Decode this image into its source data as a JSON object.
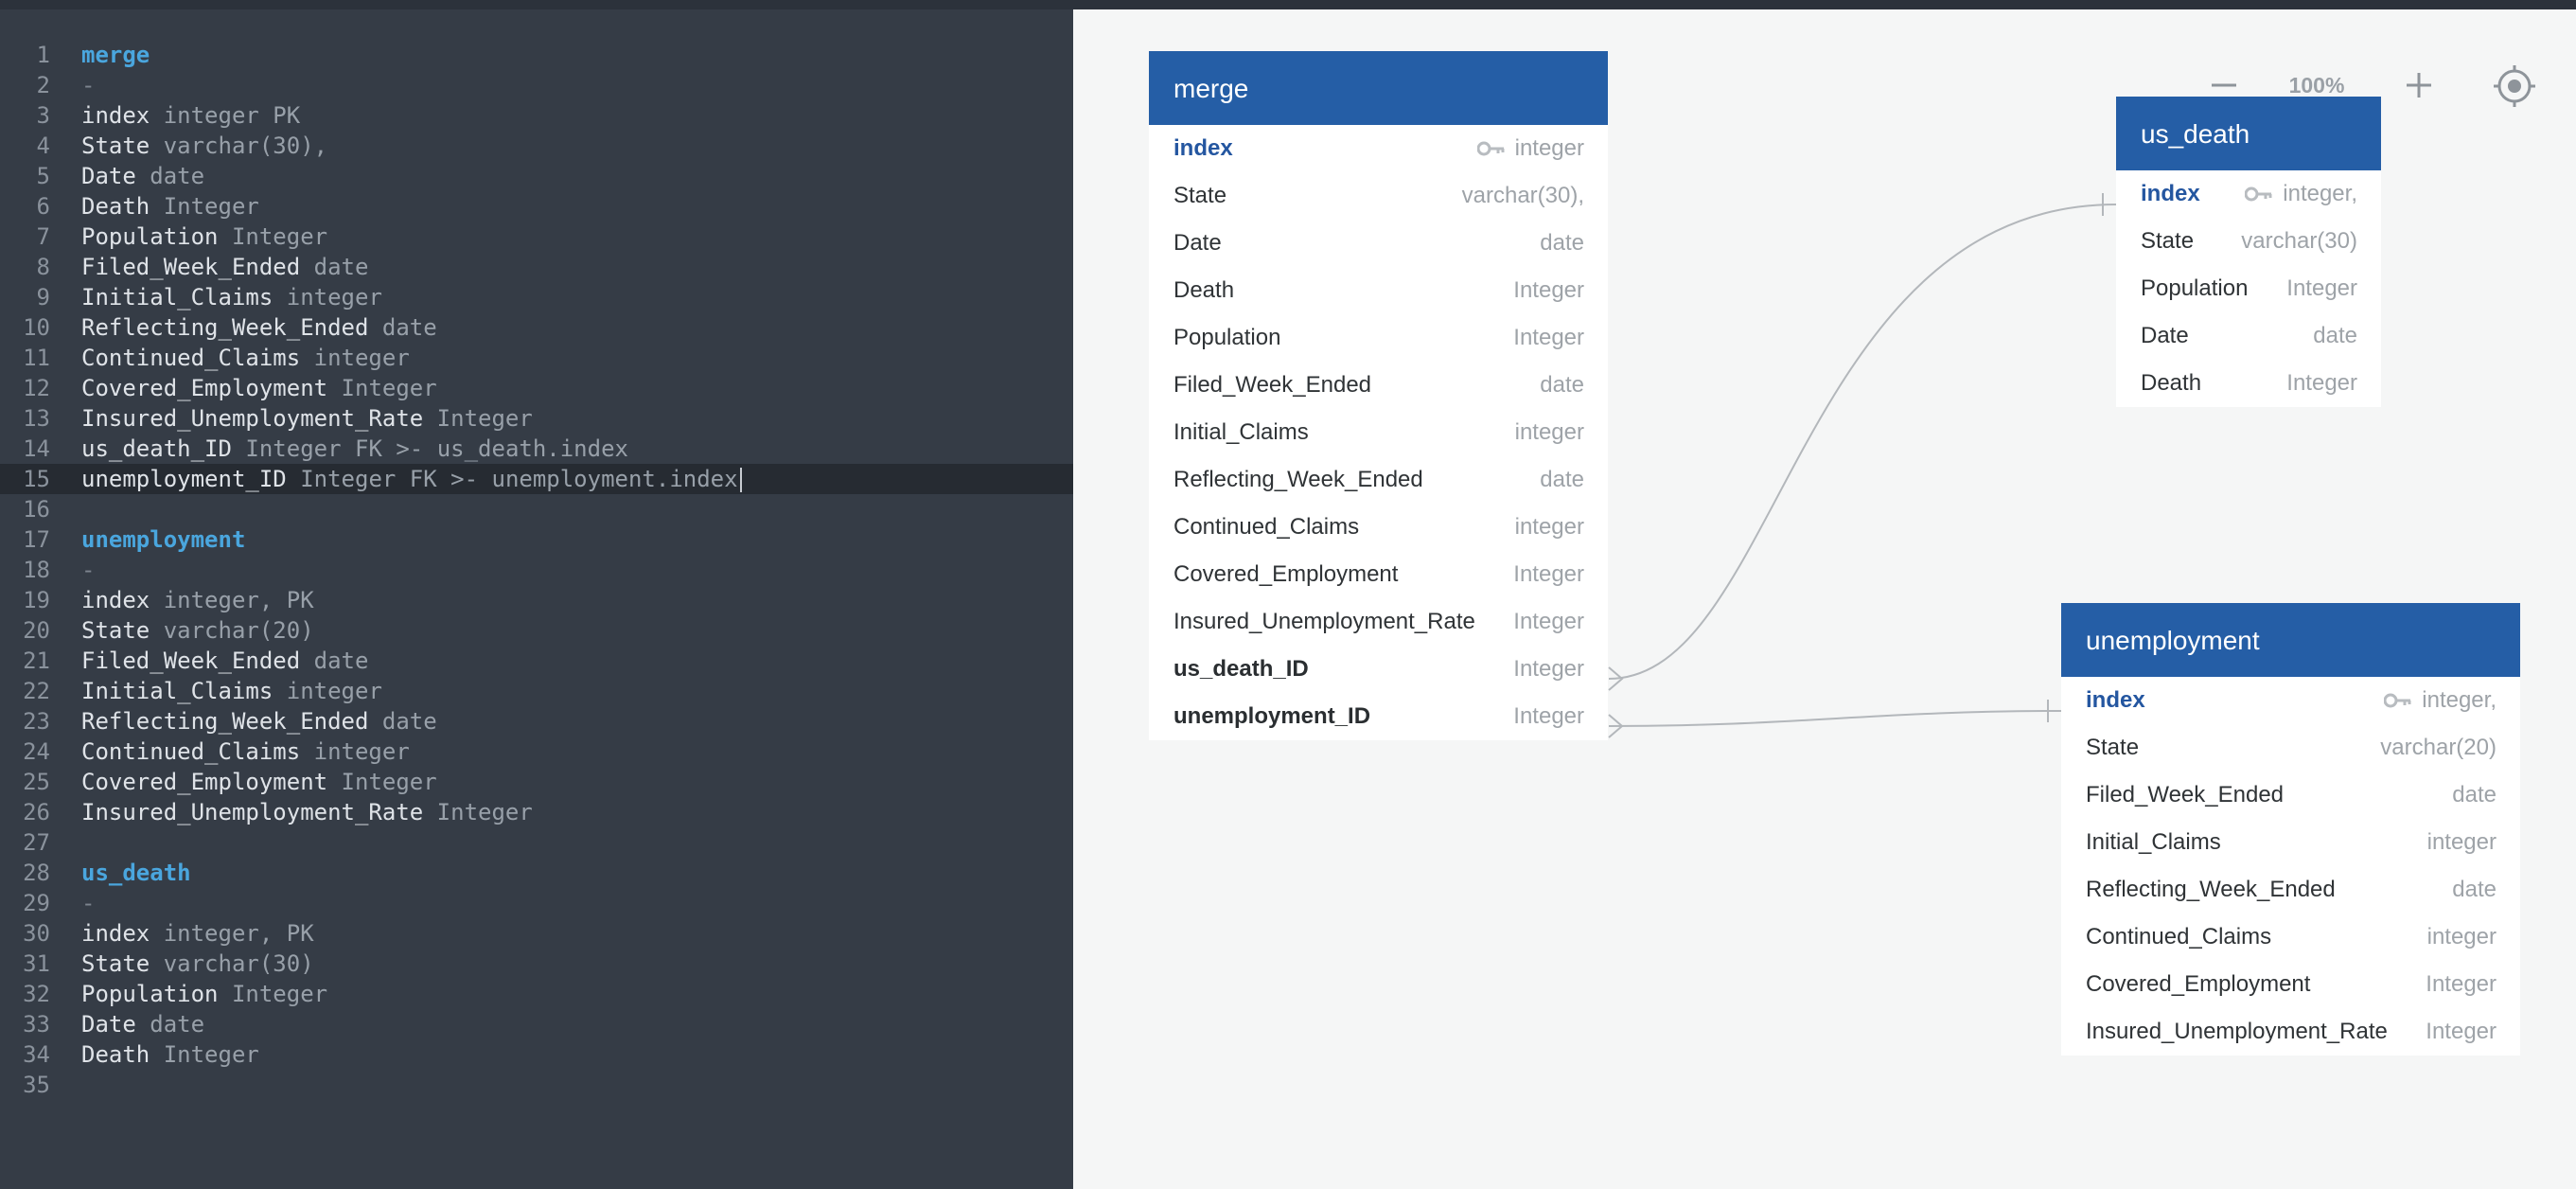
{
  "editor": {
    "lines": [
      {
        "n": "1",
        "parts": [
          {
            "t": "merge",
            "c": "table"
          }
        ]
      },
      {
        "n": "2",
        "parts": [
          {
            "t": "-",
            "c": "dash"
          }
        ]
      },
      {
        "n": "3",
        "parts": [
          {
            "t": "index",
            "c": "field"
          },
          {
            "t": " integer PK",
            "c": "type"
          }
        ]
      },
      {
        "n": "4",
        "parts": [
          {
            "t": "State",
            "c": "field"
          },
          {
            "t": " varchar(30),",
            "c": "type"
          }
        ]
      },
      {
        "n": "5",
        "parts": [
          {
            "t": "Date",
            "c": "field"
          },
          {
            "t": " date",
            "c": "type"
          }
        ]
      },
      {
        "n": "6",
        "parts": [
          {
            "t": "Death",
            "c": "field"
          },
          {
            "t": " Integer",
            "c": "type"
          }
        ]
      },
      {
        "n": "7",
        "parts": [
          {
            "t": "Population",
            "c": "field"
          },
          {
            "t": " Integer",
            "c": "type"
          }
        ]
      },
      {
        "n": "8",
        "parts": [
          {
            "t": "Filed_Week_Ended",
            "c": "field"
          },
          {
            "t": " date",
            "c": "type"
          }
        ]
      },
      {
        "n": "9",
        "parts": [
          {
            "t": "Initial_Claims",
            "c": "field"
          },
          {
            "t": " integer",
            "c": "type"
          }
        ]
      },
      {
        "n": "10",
        "parts": [
          {
            "t": "Reflecting_Week_Ended",
            "c": "field"
          },
          {
            "t": " date",
            "c": "type"
          }
        ]
      },
      {
        "n": "11",
        "parts": [
          {
            "t": "Continued_Claims",
            "c": "field"
          },
          {
            "t": " integer",
            "c": "type"
          }
        ]
      },
      {
        "n": "12",
        "parts": [
          {
            "t": "Covered_Employment",
            "c": "field"
          },
          {
            "t": " Integer",
            "c": "type"
          }
        ]
      },
      {
        "n": "13",
        "parts": [
          {
            "t": "Insured_Unemployment_Rate",
            "c": "field"
          },
          {
            "t": " Integer",
            "c": "type"
          }
        ]
      },
      {
        "n": "14",
        "parts": [
          {
            "t": "us_death_ID",
            "c": "field"
          },
          {
            "t": " Integer FK >- us_death.index",
            "c": "type"
          }
        ]
      },
      {
        "n": "15",
        "parts": [
          {
            "t": "unemployment_ID",
            "c": "field"
          },
          {
            "t": " Integer FK >- unemployment.index",
            "c": "type"
          }
        ],
        "active": true
      },
      {
        "n": "16",
        "parts": []
      },
      {
        "n": "17",
        "parts": [
          {
            "t": "unemployment",
            "c": "table"
          }
        ]
      },
      {
        "n": "18",
        "parts": [
          {
            "t": "-",
            "c": "dash"
          }
        ]
      },
      {
        "n": "19",
        "parts": [
          {
            "t": "index",
            "c": "field"
          },
          {
            "t": " integer, PK",
            "c": "type"
          }
        ]
      },
      {
        "n": "20",
        "parts": [
          {
            "t": "State",
            "c": "field"
          },
          {
            "t": " varchar(20)",
            "c": "type"
          }
        ]
      },
      {
        "n": "21",
        "parts": [
          {
            "t": "Filed_Week_Ended",
            "c": "field"
          },
          {
            "t": " date",
            "c": "type"
          }
        ]
      },
      {
        "n": "22",
        "parts": [
          {
            "t": "Initial_Claims",
            "c": "field"
          },
          {
            "t": " integer",
            "c": "type"
          }
        ]
      },
      {
        "n": "23",
        "parts": [
          {
            "t": "Reflecting_Week_Ended",
            "c": "field"
          },
          {
            "t": " date",
            "c": "type"
          }
        ]
      },
      {
        "n": "24",
        "parts": [
          {
            "t": "Continued_Claims",
            "c": "field"
          },
          {
            "t": " integer",
            "c": "type"
          }
        ]
      },
      {
        "n": "25",
        "parts": [
          {
            "t": "Covered_Employment",
            "c": "field"
          },
          {
            "t": " Integer",
            "c": "type"
          }
        ]
      },
      {
        "n": "26",
        "parts": [
          {
            "t": "Insured_Unemployment_Rate",
            "c": "field"
          },
          {
            "t": " Integer",
            "c": "type"
          }
        ]
      },
      {
        "n": "27",
        "parts": []
      },
      {
        "n": "28",
        "parts": [
          {
            "t": "us_death",
            "c": "table"
          }
        ]
      },
      {
        "n": "29",
        "parts": [
          {
            "t": "-",
            "c": "dash"
          }
        ]
      },
      {
        "n": "30",
        "parts": [
          {
            "t": "index",
            "c": "field"
          },
          {
            "t": " integer, PK",
            "c": "type"
          }
        ]
      },
      {
        "n": "31",
        "parts": [
          {
            "t": "State",
            "c": "field"
          },
          {
            "t": " varchar(30)",
            "c": "type"
          }
        ]
      },
      {
        "n": "32",
        "parts": [
          {
            "t": "Population",
            "c": "field"
          },
          {
            "t": " Integer",
            "c": "type"
          }
        ]
      },
      {
        "n": "33",
        "parts": [
          {
            "t": "Date",
            "c": "field"
          },
          {
            "t": " date",
            "c": "type"
          }
        ]
      },
      {
        "n": "34",
        "parts": [
          {
            "t": "Death",
            "c": "field"
          },
          {
            "t": " Integer",
            "c": "type"
          }
        ]
      },
      {
        "n": "35",
        "parts": []
      }
    ]
  },
  "zoom": {
    "level": "100%",
    "out_icon": "minus-icon",
    "in_icon": "plus-icon",
    "recenter_icon": "crosshair-icon"
  },
  "tables": {
    "merge": {
      "title": "merge",
      "rows": [
        {
          "name": "index",
          "type": "integer"
        },
        {
          "name": "State",
          "type": "varchar(30),"
        },
        {
          "name": "Date",
          "type": "date"
        },
        {
          "name": "Death",
          "type": "Integer"
        },
        {
          "name": "Population",
          "type": "Integer"
        },
        {
          "name": "Filed_Week_Ended",
          "type": "date"
        },
        {
          "name": "Initial_Claims",
          "type": "integer"
        },
        {
          "name": "Reflecting_Week_Ended",
          "type": "date"
        },
        {
          "name": "Continued_Claims",
          "type": "integer"
        },
        {
          "name": "Covered_Employment",
          "type": "Integer"
        },
        {
          "name": "Insured_Unemployment_Rate",
          "type": "Integer"
        },
        {
          "name": "us_death_ID",
          "type": "Integer"
        },
        {
          "name": "unemployment_ID",
          "type": "Integer"
        }
      ]
    },
    "us_death": {
      "title": "us_death",
      "rows": [
        {
          "name": "index",
          "type": "integer,"
        },
        {
          "name": "State",
          "type": "varchar(30)"
        },
        {
          "name": "Population",
          "type": "Integer"
        },
        {
          "name": "Date",
          "type": "date"
        },
        {
          "name": "Death",
          "type": "Integer"
        }
      ]
    },
    "unemployment": {
      "title": "unemployment",
      "rows": [
        {
          "name": "index",
          "type": "integer,"
        },
        {
          "name": "State",
          "type": "varchar(20)"
        },
        {
          "name": "Filed_Week_Ended",
          "type": "date"
        },
        {
          "name": "Initial_Claims",
          "type": "integer"
        },
        {
          "name": "Reflecting_Week_Ended",
          "type": "date"
        },
        {
          "name": "Continued_Claims",
          "type": "integer"
        },
        {
          "name": "Covered_Employment",
          "type": "Integer"
        },
        {
          "name": "Insured_Unemployment_Rate",
          "type": "Integer"
        }
      ]
    }
  }
}
